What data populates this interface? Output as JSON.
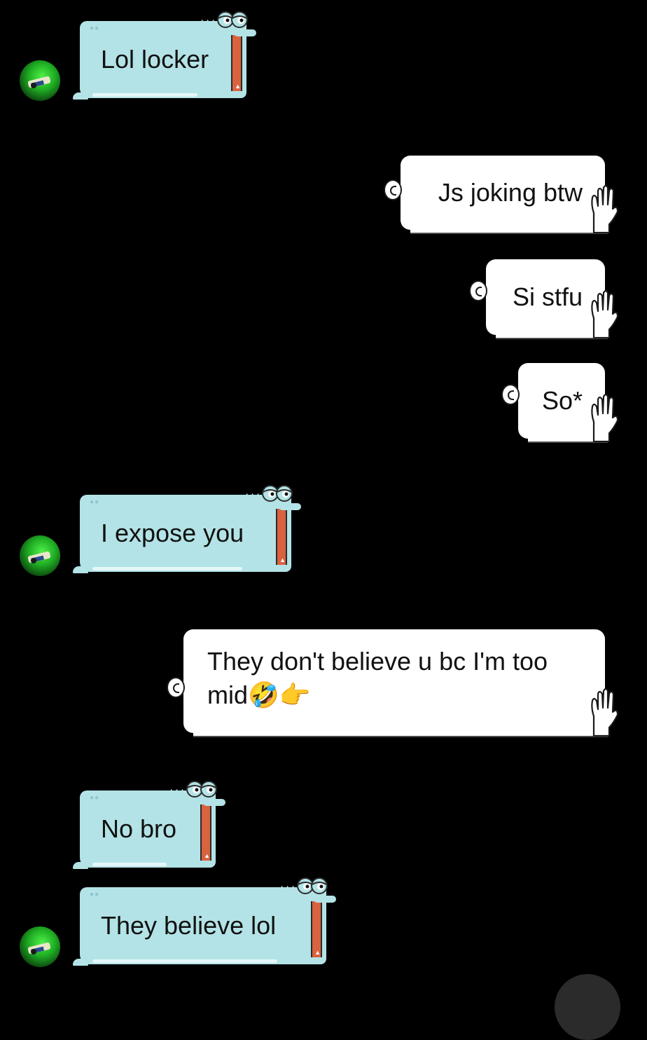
{
  "theme": {
    "background": "#000000",
    "incoming_bubble": "#b3e3e6",
    "outgoing_bubble": "#ffffff",
    "croc_mouth": "#d9623f",
    "hair": "#2d0f0d",
    "avatar_green": "#1fae23"
  },
  "contact": {
    "avatar_icon": "green-game-avatar"
  },
  "messages": [
    {
      "id": "m1",
      "direction": "incoming",
      "style": "crocodile",
      "text": "Lol locker"
    },
    {
      "id": "m2",
      "direction": "outgoing",
      "style": "character-hand",
      "text": "Js joking btw"
    },
    {
      "id": "m3",
      "direction": "outgoing",
      "style": "character-hand",
      "text": "Si stfu"
    },
    {
      "id": "m4",
      "direction": "outgoing",
      "style": "character-hand",
      "text": "So*"
    },
    {
      "id": "m5",
      "direction": "incoming",
      "style": "crocodile",
      "text": "I expose you"
    },
    {
      "id": "m6",
      "direction": "outgoing",
      "style": "character-hand",
      "text": "They don't believe u bc I'm too mid🤣👉"
    },
    {
      "id": "m7",
      "direction": "incoming",
      "style": "crocodile",
      "text": "No bro"
    },
    {
      "id": "m8",
      "direction": "incoming",
      "style": "crocodile",
      "text": "They believe lol"
    }
  ]
}
